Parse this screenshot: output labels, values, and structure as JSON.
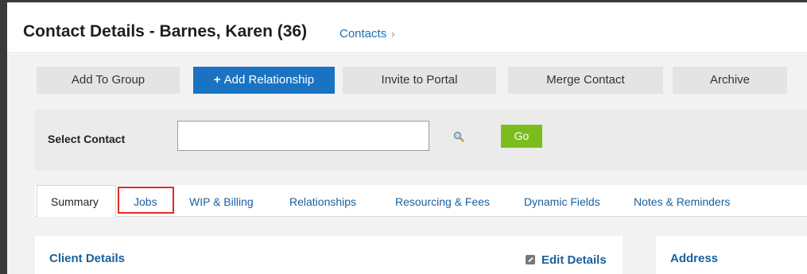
{
  "header": {
    "title": "Contact Details - Barnes, Karen (36)",
    "breadcrumb": "Contacts",
    "breadcrumb_chevron": "›"
  },
  "actions": {
    "add_to_group": "Add To Group",
    "add_relationship": "Add Relationship",
    "add_relationship_icon": "+",
    "invite_to_portal": "Invite to Portal",
    "merge_contact": "Merge Contact",
    "archive": "Archive"
  },
  "select_contact": {
    "label": "Select Contact",
    "value": "",
    "placeholder": "",
    "go": "Go"
  },
  "tabs": [
    {
      "label": "Summary"
    },
    {
      "label": "Jobs"
    },
    {
      "label": "WIP & Billing"
    },
    {
      "label": "Relationships"
    },
    {
      "label": "Resourcing & Fees"
    },
    {
      "label": "Dynamic Fields"
    },
    {
      "label": "Notes & Reminders"
    }
  ],
  "panels": {
    "client_details": "Client Details",
    "edit_details": "Edit Details",
    "address": "Address"
  },
  "colors": {
    "primary": "#1a73c2",
    "go": "#7cbd1e",
    "link": "#1a5f9e",
    "highlight": "#e02a2a"
  },
  "icons": [
    "search-icon",
    "edit-icon",
    "plus-icon",
    "chevron-right-icon"
  ]
}
